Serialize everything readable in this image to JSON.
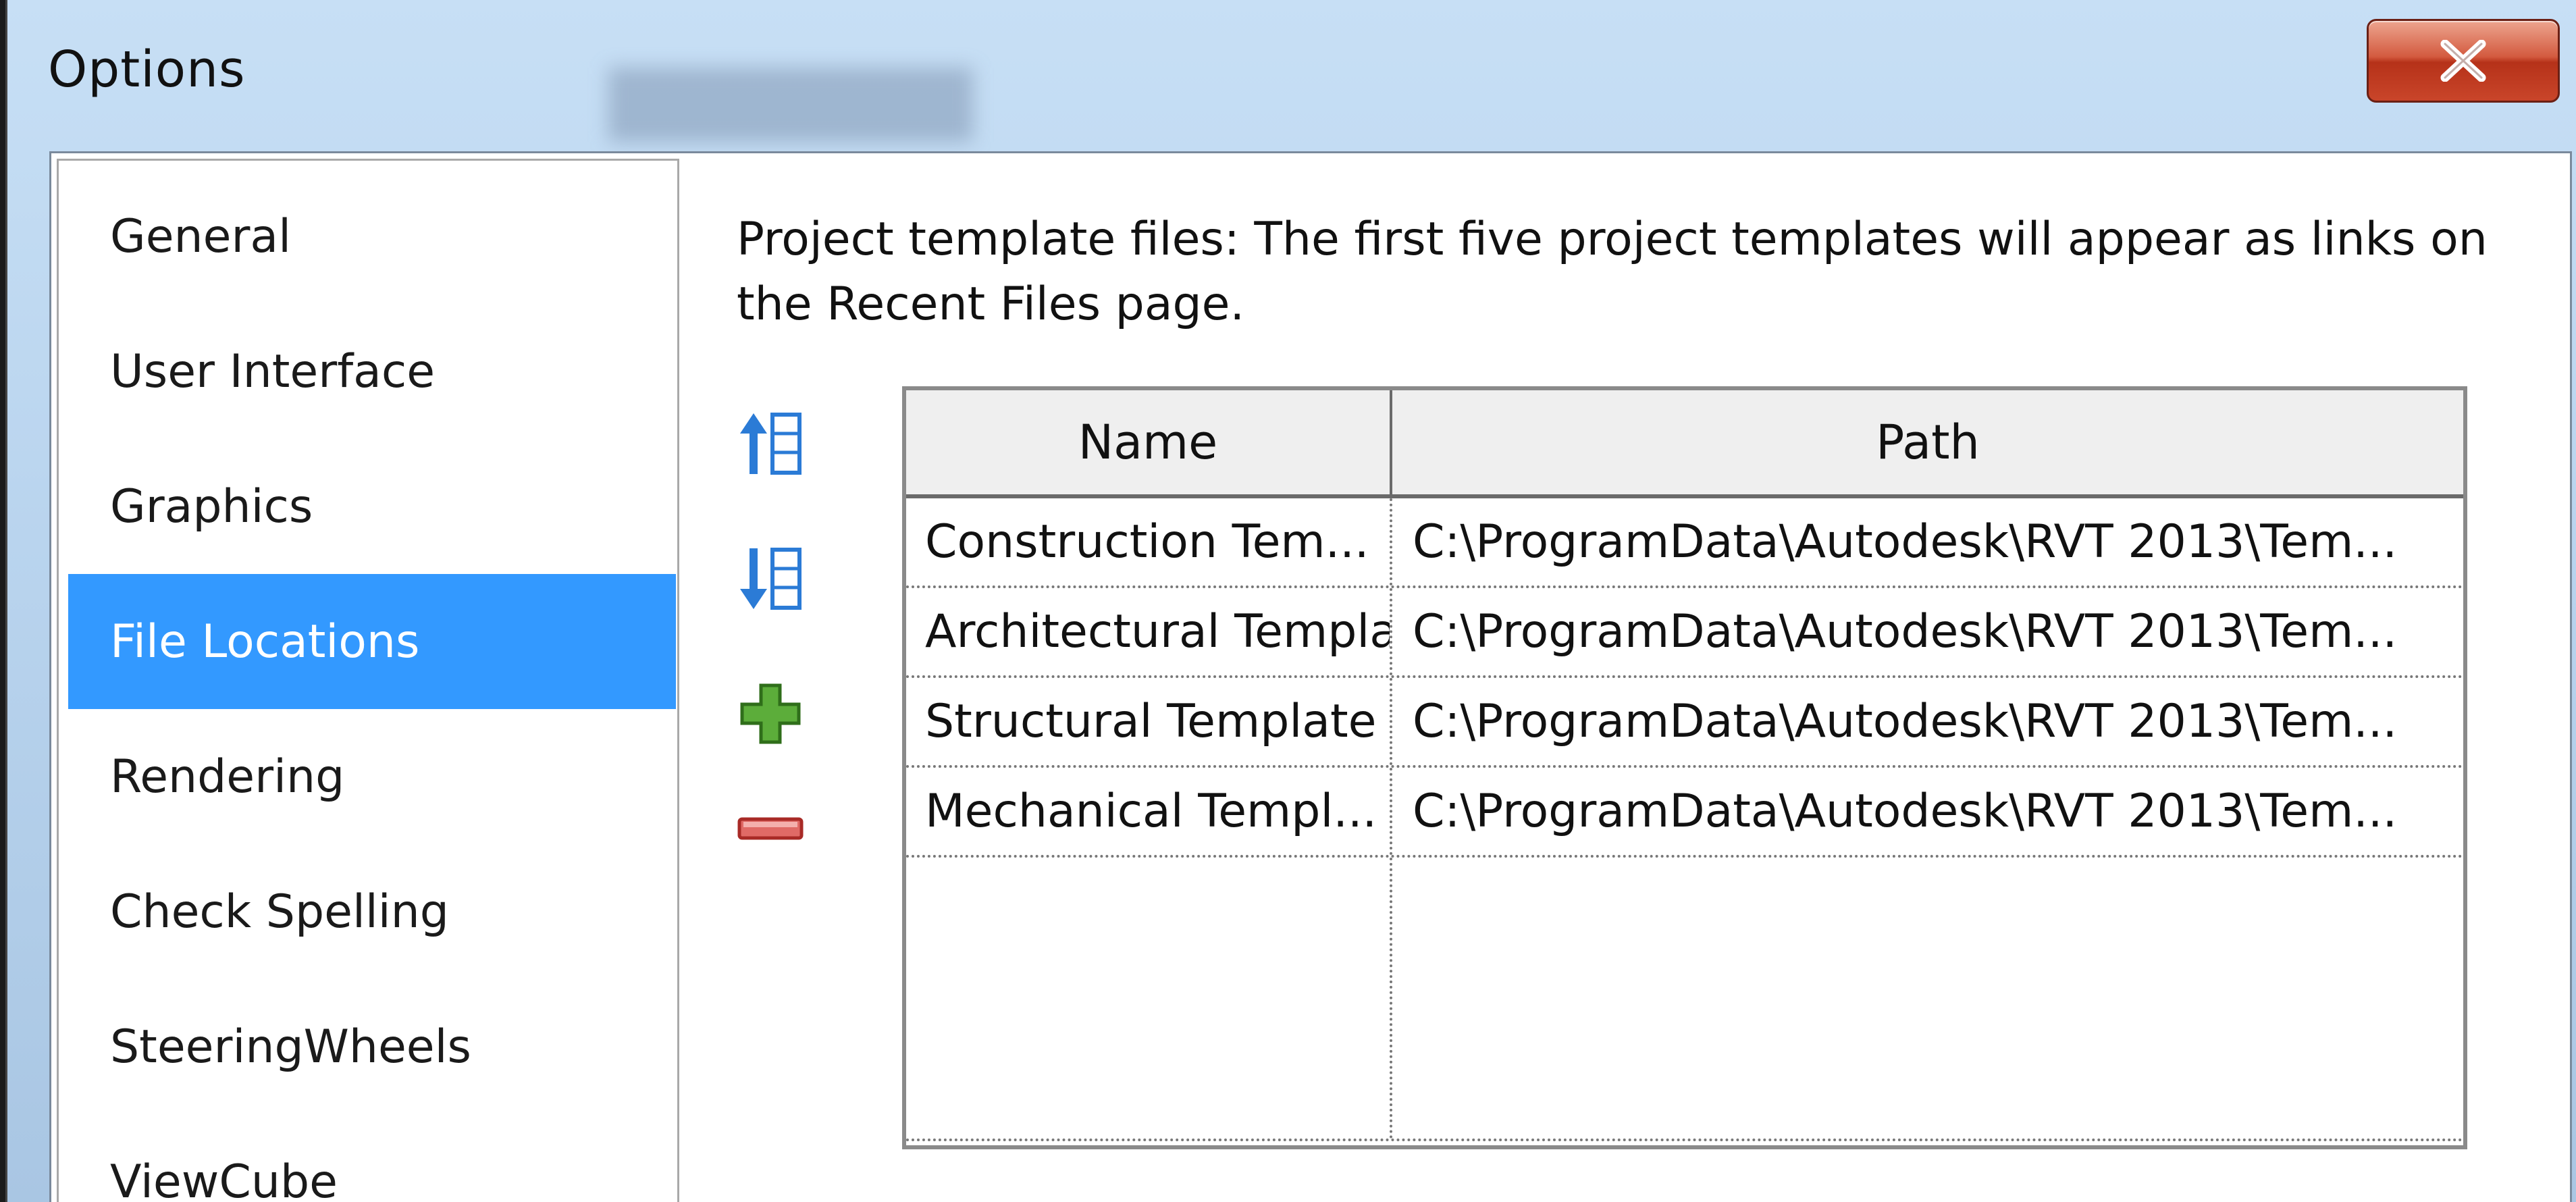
{
  "window": {
    "title": "Options"
  },
  "sidebar": {
    "items": [
      {
        "label": "General",
        "selected": false
      },
      {
        "label": "User Interface",
        "selected": false
      },
      {
        "label": "Graphics",
        "selected": false
      },
      {
        "label": "File Locations",
        "selected": true
      },
      {
        "label": "Rendering",
        "selected": false
      },
      {
        "label": "Check Spelling",
        "selected": false
      },
      {
        "label": "SteeringWheels",
        "selected": false
      },
      {
        "label": "ViewCube",
        "selected": false
      }
    ]
  },
  "panel": {
    "description": "Project template files:  The first five project templates will appear as links on the Recent Files page."
  },
  "toolbar": {
    "move_up_icon": "move-up-icon",
    "move_down_icon": "move-down-icon",
    "add_icon": "plus-icon",
    "remove_icon": "minus-icon"
  },
  "table": {
    "columns": [
      "Name",
      "Path"
    ],
    "rows": [
      {
        "name": "Construction Tem...",
        "path": "C:\\ProgramData\\Autodesk\\RVT 2013\\Tem..."
      },
      {
        "name": "Architectural Templa",
        "path": "C:\\ProgramData\\Autodesk\\RVT 2013\\Tem..."
      },
      {
        "name": "Structural Template",
        "path": "C:\\ProgramData\\Autodesk\\RVT 2013\\Tem..."
      },
      {
        "name": "Mechanical Templ...",
        "path": "C:\\ProgramData\\Autodesk\\RVT 2013\\Tem..."
      }
    ]
  },
  "colors": {
    "selection": "#3399ff",
    "add_green": "#4e9a2a",
    "remove_red": "#d9534f",
    "arrow_blue": "#2b7bd6"
  }
}
